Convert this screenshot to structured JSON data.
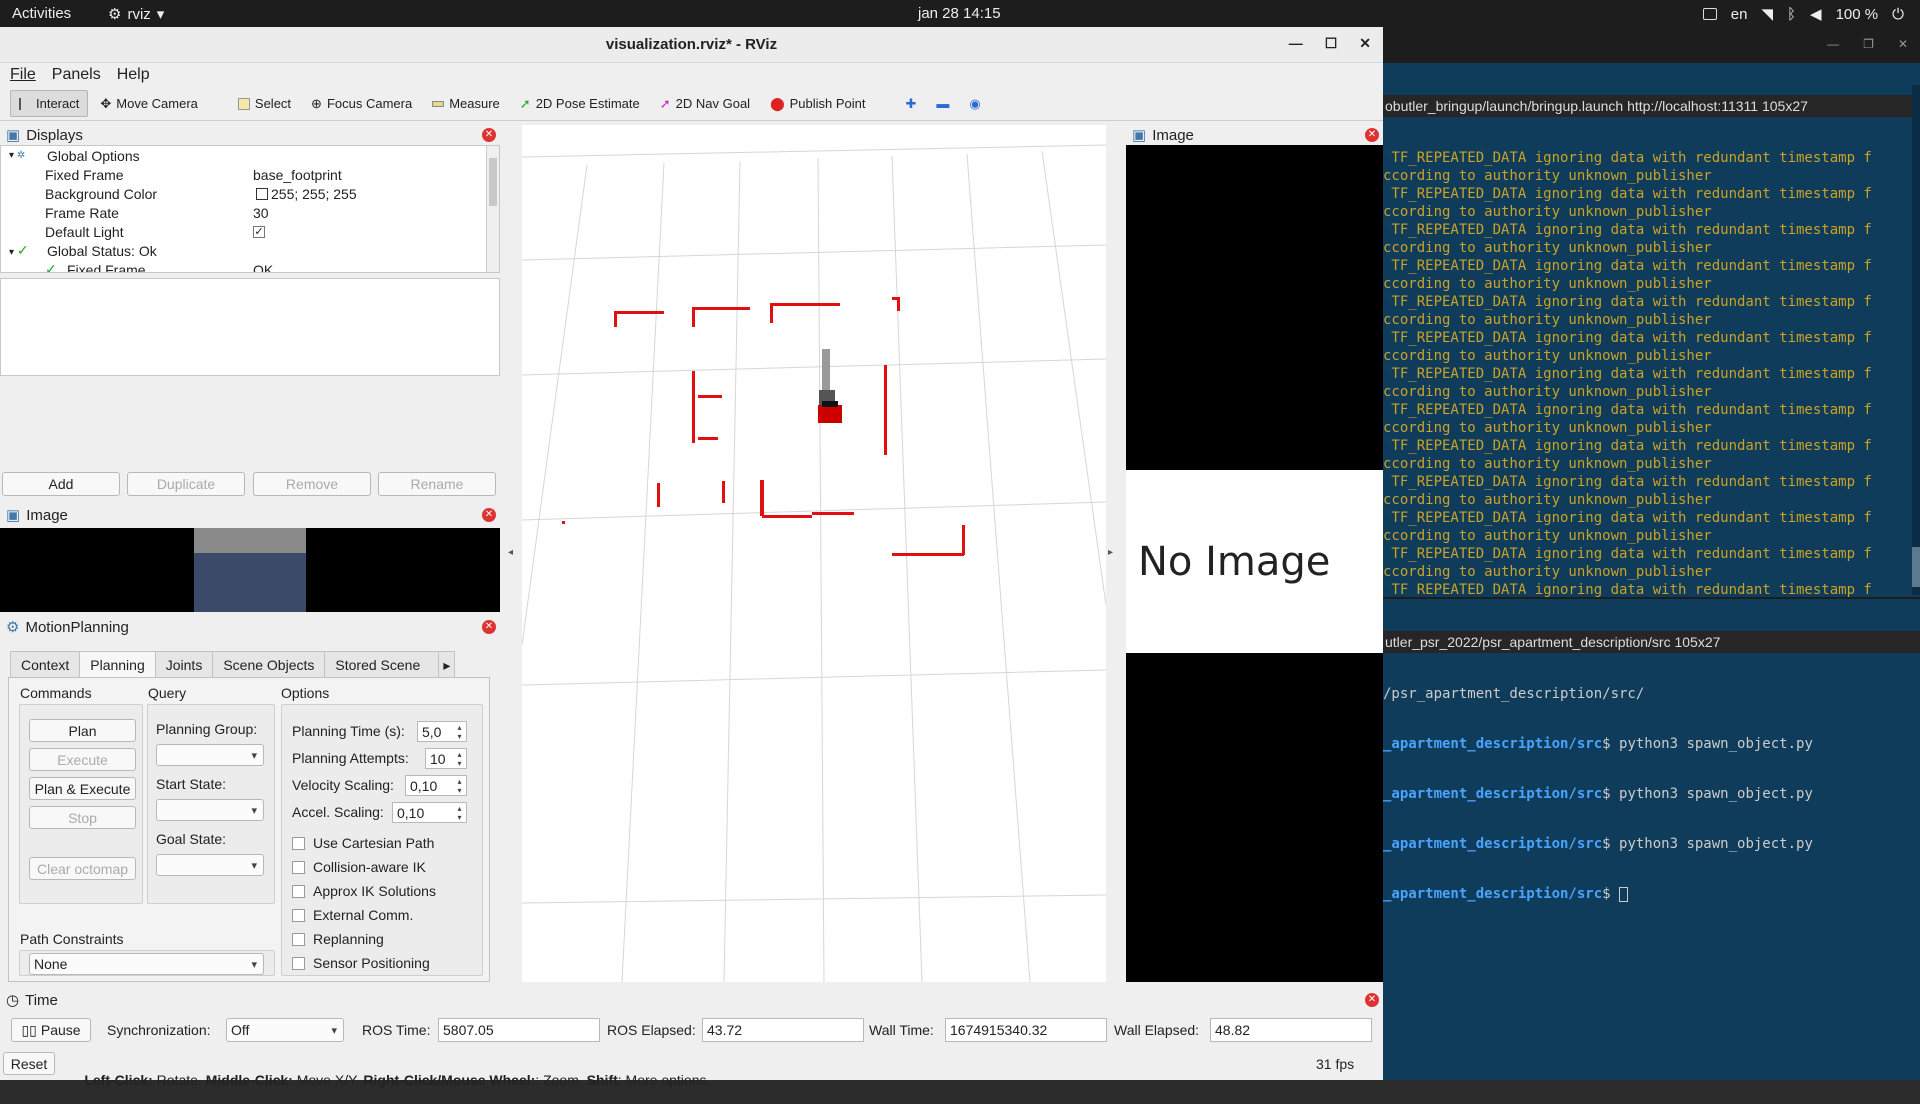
{
  "topbar": {
    "activities": "Activities",
    "app": "rviz",
    "datetime": "jan 28  14:15",
    "lang": "en",
    "battery": "100 %"
  },
  "rviz": {
    "title": "visualization.rviz* - RViz",
    "menu": [
      "File",
      "Panels",
      "Help"
    ],
    "toolbar": [
      "Interact",
      "Move Camera",
      "Select",
      "Focus Camera",
      "Measure",
      "2D Pose Estimate",
      "2D Nav Goal",
      "Publish Point"
    ],
    "displays": {
      "title": "Displays",
      "rows": [
        {
          "k": "Global Options",
          "v": ""
        },
        {
          "k": "Fixed Frame",
          "v": "base_footprint"
        },
        {
          "k": "Background Color",
          "v": "255; 255; 255"
        },
        {
          "k": "Frame Rate",
          "v": "30"
        },
        {
          "k": "Default Light",
          "v": "✓"
        },
        {
          "k": "Global Status: Ok",
          "v": ""
        },
        {
          "k": "Fixed Frame",
          "v": "OK"
        }
      ],
      "buttons": [
        "Add",
        "Duplicate",
        "Remove",
        "Rename"
      ]
    },
    "image_small_title": "Image",
    "motion": {
      "title": "MotionPlanning",
      "tabs": [
        "Context",
        "Planning",
        "Joints",
        "Scene Objects",
        "Stored Scene"
      ],
      "commands_label": "Commands",
      "query_label": "Query",
      "options_label": "Options",
      "buttons": [
        "Plan",
        "Execute",
        "Plan & Execute",
        "Stop",
        "Clear octomap"
      ],
      "planning_group": "Planning Group:",
      "start_state": "Start State:",
      "goal_state": "Goal State:",
      "planning_time_label": "Planning Time (s):",
      "planning_time": "5,0",
      "attempts_label": "Planning Attempts:",
      "attempts": "10",
      "vel_label": "Velocity Scaling:",
      "vel": "0,10",
      "acc_label": "Accel. Scaling:",
      "acc": "0,10",
      "checks": [
        "Use Cartesian Path",
        "Collision-aware IK",
        "Approx IK Solutions",
        "External Comm.",
        "Replanning",
        "Sensor Positioning"
      ],
      "path_constraints": "Path Constraints",
      "path_value": "None"
    },
    "image_panel": {
      "title": "Image",
      "no_image": "No Image"
    },
    "time": {
      "title": "Time",
      "pause": "Pause",
      "sync_label": "Synchronization:",
      "sync": "Off",
      "ros_time_label": "ROS Time:",
      "ros_time": "5807.05",
      "ros_elapsed_label": "ROS Elapsed:",
      "ros_elapsed": "43.72",
      "wall_time_label": "Wall Time:",
      "wall_time": "1674915340.32",
      "wall_elapsed_label": "Wall Elapsed:",
      "wall_elapsed": "48.82"
    },
    "status": {
      "reset": "Reset",
      "fps": "31 fps",
      "left_click": "Left-Click:",
      "left_act": " Rotate. ",
      "middle_click": "Middle-Click:",
      "middle_act": " Move X/Y. ",
      "right_click": "Right-Click/Mouse Wheel:",
      "right_act": ": Zoom. ",
      "shift": "Shift",
      "shift_act": ": More options."
    }
  },
  "terminal": {
    "top_title": "obutler_bringup/launch/bringup.launch http://localhost:11311 105x27",
    "warn1": " TF_REPEATED_DATA ignoring data with redundant timestamp f",
    "warn2": "ccording to authority unknown_publisher",
    "bottom_title": "utler_psr_2022/psr_apartment_description/src 105x27",
    "cwd": "/psr_apartment_description/src/",
    "prompt": "_apartment_description/src",
    "cmd": "$ python3 spawn_object.py",
    "cursor": "$ "
  }
}
